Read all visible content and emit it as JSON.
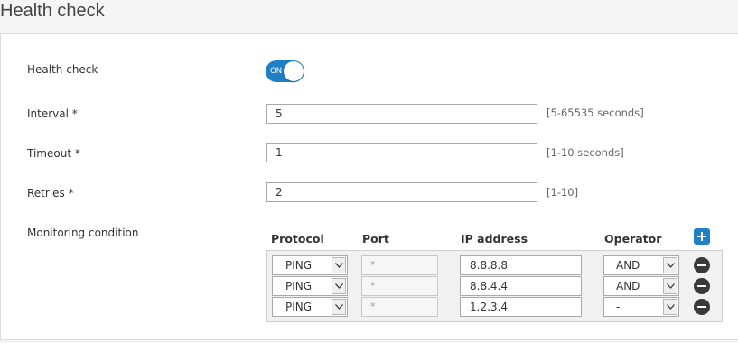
{
  "header": {
    "title": "Health check"
  },
  "form": {
    "health_check": {
      "label": "Health check",
      "toggle_text": "ON",
      "enabled": true
    },
    "interval": {
      "label": "Interval *",
      "value": "5",
      "hint": "[5-65535 seconds]"
    },
    "timeout": {
      "label": "Timeout *",
      "value": "1",
      "hint": "[1-10 seconds]"
    },
    "retries": {
      "label": "Retries *",
      "value": "2",
      "hint": "[1-10]"
    },
    "monitoring": {
      "label": "Monitoring condition",
      "columns": {
        "protocol": "Protocol",
        "port": "Port",
        "ip": "IP address",
        "operator": "Operator"
      },
      "rows": [
        {
          "protocol": "PING",
          "port": "*",
          "ip": "8.8.8.8",
          "operator": "AND"
        },
        {
          "protocol": "PING",
          "port": "*",
          "ip": "8.8.4.4",
          "operator": "AND"
        },
        {
          "protocol": "PING",
          "port": "*",
          "ip": "1.2.3.4",
          "operator": "-"
        }
      ]
    }
  },
  "icons": {
    "add": "plus-icon",
    "remove": "minus-icon",
    "dropdown": "chevron-down-icon"
  },
  "colors": {
    "accent": "#1f80c8",
    "remove": "#3a3a3a"
  }
}
